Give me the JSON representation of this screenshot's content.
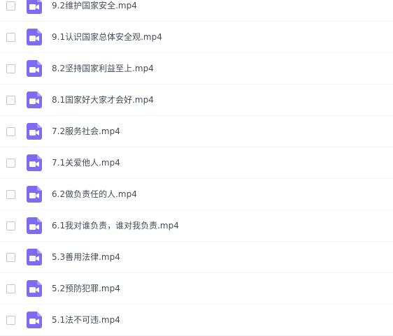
{
  "file_list": {
    "icon": "video-file-icon",
    "icon_color": "#7c6cf2",
    "items": [
      {
        "name": "9.2维护国家安全.mp4"
      },
      {
        "name": "9.1认识国家总体安全观.mp4"
      },
      {
        "name": "8.2坚持国家利益至上.mp4"
      },
      {
        "name": "8.1国家好大家才会好.mp4"
      },
      {
        "name": "7.2服务社会.mp4"
      },
      {
        "name": "7.1关爱他人.mp4"
      },
      {
        "name": "6.2做负责任的人.mp4"
      },
      {
        "name": "6.1我对谁负责，谁对我负责.mp4"
      },
      {
        "name": "5.3善用法律.mp4"
      },
      {
        "name": "5.2预防犯罪.mp4"
      },
      {
        "name": "5.1法不可违.mp4"
      }
    ]
  }
}
